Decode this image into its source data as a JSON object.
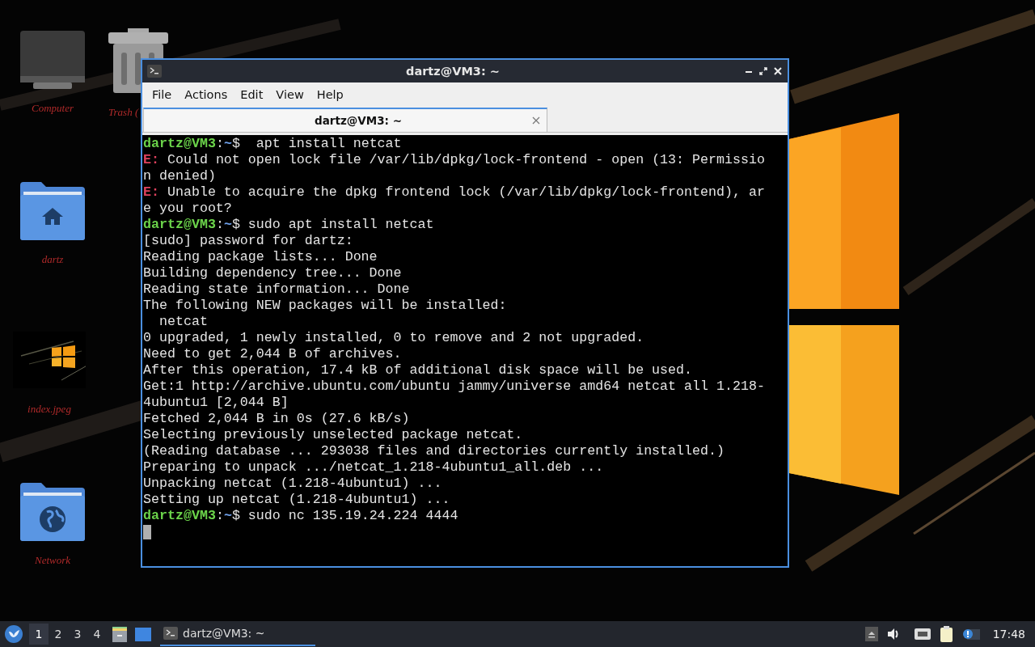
{
  "desktop_icons": [
    {
      "kind": "computer",
      "label": "Computer"
    },
    {
      "kind": "trash",
      "label": "Trash ("
    },
    {
      "kind": "home_folder",
      "label": "dartz"
    },
    {
      "label": "index.jpeg"
    },
    {
      "kind": "network_folder",
      "label": "Network"
    }
  ],
  "window": {
    "title": "dartz@VM3: ~",
    "menu": [
      "File",
      "Actions",
      "Edit",
      "View",
      "Help"
    ],
    "tabs": [
      {
        "label": "dartz@VM3: ~",
        "selected": true
      }
    ],
    "lines": [
      [
        {
          "kind": "user",
          "text": "dartz@VM3"
        },
        {
          "kind": "plain",
          "text": ":"
        },
        {
          "kind": "path",
          "text": "~"
        },
        {
          "kind": "plain",
          "text": "$  apt install netcat"
        }
      ],
      [
        {
          "kind": "error",
          "text": "E:"
        },
        {
          "kind": "plain",
          "text": " Could not open lock file /var/lib/dpkg/lock-frontend - open (13: Permissio"
        }
      ],
      [
        {
          "kind": "plain",
          "text": "n denied)"
        }
      ],
      [
        {
          "kind": "error",
          "text": "E:"
        },
        {
          "kind": "plain",
          "text": " Unable to acquire the dpkg frontend lock (/var/lib/dpkg/lock-frontend), ar"
        }
      ],
      [
        {
          "kind": "plain",
          "text": "e you root?"
        }
      ],
      [
        {
          "kind": "user",
          "text": "dartz@VM3"
        },
        {
          "kind": "plain",
          "text": ":"
        },
        {
          "kind": "path",
          "text": "~"
        },
        {
          "kind": "plain",
          "text": "$ sudo apt install netcat"
        }
      ],
      [
        {
          "kind": "plain",
          "text": "[sudo] password for dartz:"
        }
      ],
      [
        {
          "kind": "plain",
          "text": "Reading package lists... Done"
        }
      ],
      [
        {
          "kind": "plain",
          "text": "Building dependency tree... Done"
        }
      ],
      [
        {
          "kind": "plain",
          "text": "Reading state information... Done"
        }
      ],
      [
        {
          "kind": "plain",
          "text": "The following NEW packages will be installed:"
        }
      ],
      [
        {
          "kind": "plain",
          "text": "  netcat"
        }
      ],
      [
        {
          "kind": "plain",
          "text": "0 upgraded, 1 newly installed, 0 to remove and 2 not upgraded."
        }
      ],
      [
        {
          "kind": "plain",
          "text": "Need to get 2,044 B of archives."
        }
      ],
      [
        {
          "kind": "plain",
          "text": "After this operation, 17.4 kB of additional disk space will be used."
        }
      ],
      [
        {
          "kind": "plain",
          "text": "Get:1 http://archive.ubuntu.com/ubuntu jammy/universe amd64 netcat all 1.218-"
        }
      ],
      [
        {
          "kind": "plain",
          "text": "4ubuntu1 [2,044 B]"
        }
      ],
      [
        {
          "kind": "plain",
          "text": "Fetched 2,044 B in 0s (27.6 kB/s)"
        }
      ],
      [
        {
          "kind": "plain",
          "text": "Selecting previously unselected package netcat."
        }
      ],
      [
        {
          "kind": "plain",
          "text": "(Reading database ... 293038 files and directories currently installed.)"
        }
      ],
      [
        {
          "kind": "plain",
          "text": "Preparing to unpack .../netcat_1.218-4ubuntu1_all.deb ..."
        }
      ],
      [
        {
          "kind": "plain",
          "text": "Unpacking netcat (1.218-4ubuntu1) ..."
        }
      ],
      [
        {
          "kind": "plain",
          "text": "Setting up netcat (1.218-4ubuntu1) ..."
        }
      ],
      [
        {
          "kind": "user",
          "text": "dartz@VM3"
        },
        {
          "kind": "plain",
          "text": ":"
        },
        {
          "kind": "path",
          "text": "~"
        },
        {
          "kind": "plain",
          "text": "$ sudo nc 135.19.24.224 4444"
        }
      ]
    ],
    "cursor": true
  },
  "taskbar": {
    "workspaces": [
      {
        "label": "1",
        "selected": true
      },
      {
        "label": "2",
        "selected": false
      },
      {
        "label": "3",
        "selected": false
      },
      {
        "label": "4",
        "selected": false
      }
    ],
    "tasks": [
      {
        "label": "dartz@VM3: ~",
        "selected": true
      }
    ],
    "clock": "17:48"
  }
}
